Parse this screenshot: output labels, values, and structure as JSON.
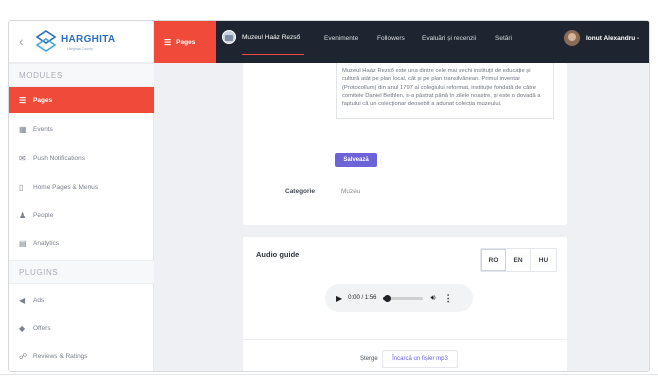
{
  "brand": {
    "name": "HARGHITA",
    "tagline": "Harghita County"
  },
  "sidebar": {
    "modules_label": "MODULES",
    "plugins_label": "PLUGINS",
    "modules": [
      {
        "label": "Pages",
        "icon": "list-icon",
        "active": true
      },
      {
        "label": "Events",
        "icon": "calendar-icon",
        "active": false
      },
      {
        "label": "Push Notifications",
        "icon": "mail-icon",
        "active": false
      },
      {
        "label": "Home Pages & Menus",
        "icon": "phone-icon",
        "active": false
      },
      {
        "label": "People",
        "icon": "person-icon",
        "active": false
      },
      {
        "label": "Analytics",
        "icon": "chart-icon",
        "active": false
      }
    ],
    "plugins": [
      {
        "label": "Ads",
        "icon": "megaphone-icon"
      },
      {
        "label": "Offers",
        "icon": "tag-icon"
      },
      {
        "label": "Reviews & Ratings",
        "icon": "chat-icon"
      }
    ]
  },
  "topbar": {
    "pages_label": "Pages",
    "museum_label": "Muzeul Haáz Rezső",
    "links": [
      "Evenimente",
      "Followers",
      "Evaluări și recenzii",
      "Setări"
    ],
    "user_name": "Ionut Alexandru",
    "accent": "#f04a3a",
    "bg": "#1f2530"
  },
  "content": {
    "description": "Muzeul Haáz Rezső este una dintre cele mai vechi instituții de educație și cultură atât pe plan local, cât și pe plan transilvănean. Primul inventar (Protocollum) din anul 1797 al colegiului reformat, instituție fondată de către comitele Daniel Bethlen, s-a păstrat până în zilele noastre, și este o dovadă a faptului că un colecționar deosebit a adunat colecția muzeului.",
    "save_button": "Salvează",
    "category_label": "Categorie",
    "category_value": "Muzeu"
  },
  "audio_guide": {
    "title": "Audio guide",
    "languages": [
      "RO",
      "EN",
      "HU"
    ],
    "time_display": "0:00 / 1:56",
    "progress": 0.1,
    "delete_label": "Șterge",
    "upload_label": "Încarcă un fișier mp3"
  }
}
